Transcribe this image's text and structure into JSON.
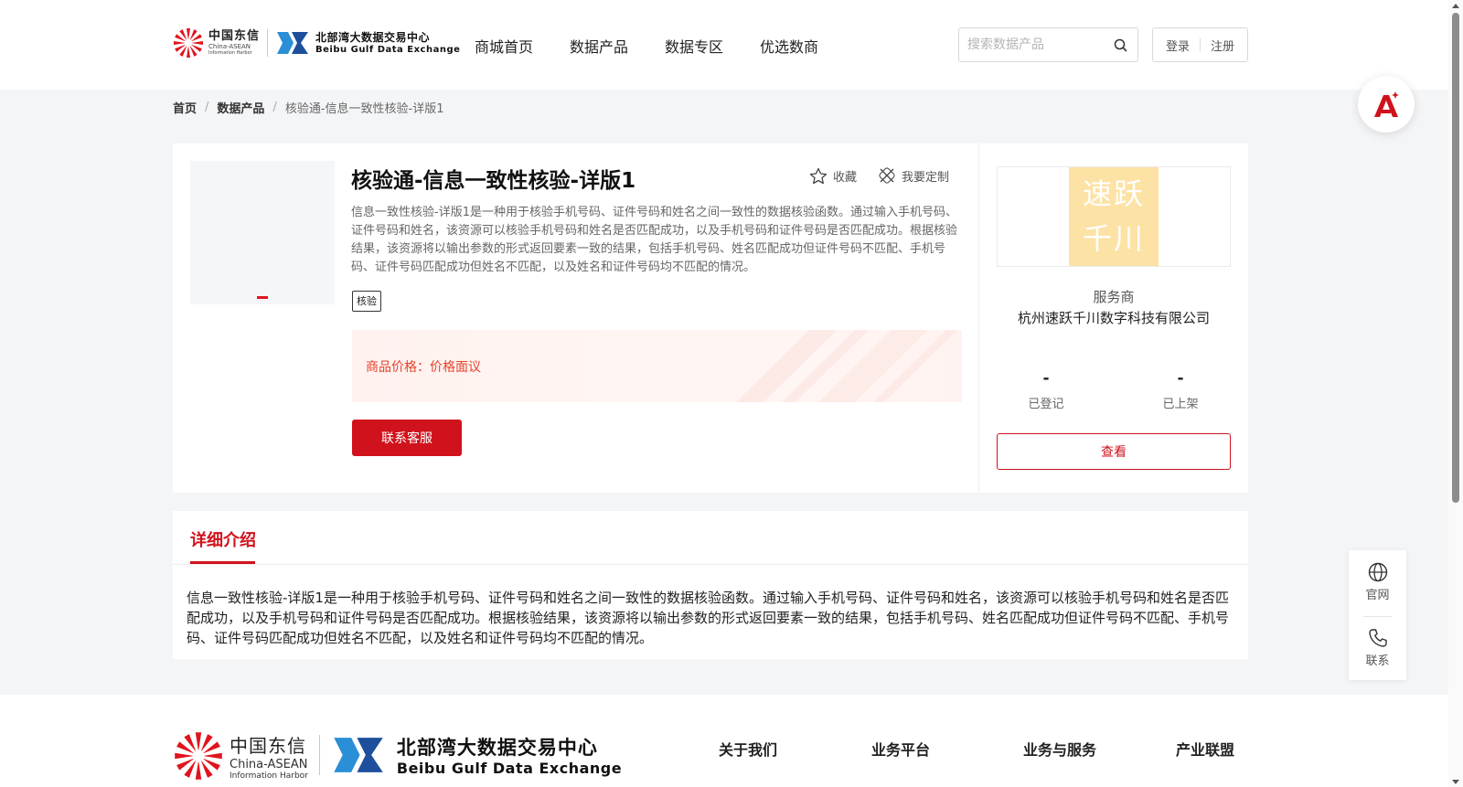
{
  "header": {
    "logo_ct_cn": "中国东信",
    "logo_ct_en": "China-ASEAN",
    "logo_ct_en2": "Information Harbor",
    "logo_bg_cn": "北部湾大数据交易中心",
    "logo_bg_en": "Beibu Gulf Data Exchange",
    "nav": [
      "商城首页",
      "数据产品",
      "数据专区",
      "优选数商"
    ],
    "search_placeholder": "搜索数据产品",
    "login": "登录",
    "register": "注册"
  },
  "breadcrumb": [
    "首页",
    "数据产品",
    "核验通-信息一致性核验-详版1"
  ],
  "product": {
    "title": "核验通-信息一致性核验-详版1",
    "favorite": "收藏",
    "customize": "我要定制",
    "description": "信息一致性核验-详版1是一种用于核验手机号码、证件号码和姓名之间一致性的数据核验函数。通过输入手机号码、证件号码和姓名，该资源可以核验手机号码和姓名是否匹配成功，以及手机号码和证件号码是否匹配成功。根据核验结果，该资源将以输出参数的形式返回要素一致的结果，包括手机号码、姓名匹配成功但证件号码不匹配、手机号码、证件号码匹配成功但姓名不匹配，以及姓名和证件号码均不匹配的情况。",
    "tag": "核验",
    "price_label": "商品价格：",
    "price_value": "价格面议",
    "contact_button": "联系客服"
  },
  "provider": {
    "logo_line1": "速跃",
    "logo_line2": "千川",
    "label": "服务商",
    "name": "杭州速跃千川数字科技有限公司",
    "registered_value": "-",
    "registered_label": "已登记",
    "listed_value": "-",
    "listed_label": "已上架",
    "view_button": "查看"
  },
  "detail": {
    "tab": "详细介绍",
    "text": "信息一致性核验-详版1是一种用于核验手机号码、证件号码和姓名之间一致性的数据核验函数。通过输入手机号码、证件号码和姓名，该资源可以核验手机号码和姓名是否匹配成功，以及手机号码和证件号码是否匹配成功。根据核验结果，该资源将以输出参数的形式返回要素一致的结果，包括手机号码、姓名匹配成功但证件号码不匹配、手机号码、证件号码匹配成功但姓名不匹配，以及姓名和证件号码均不匹配的情况。"
  },
  "float": {
    "official": "官网",
    "contact": "联系"
  },
  "footer": {
    "logo_ct_cn": "中国东信",
    "logo_ct_en": "China-ASEAN",
    "logo_ct_en2": "Information Harbor",
    "logo_bg_cn": "北部湾大数据交易中心",
    "logo_bg_en": "Beibu Gulf Data Exchange",
    "nav": [
      "关于我们",
      "业务平台",
      "业务与服务",
      "产业联盟"
    ]
  },
  "colors": {
    "accent": "#d0121c",
    "price": "#e6422a",
    "provider_logo_bg": "#fde2a5"
  }
}
